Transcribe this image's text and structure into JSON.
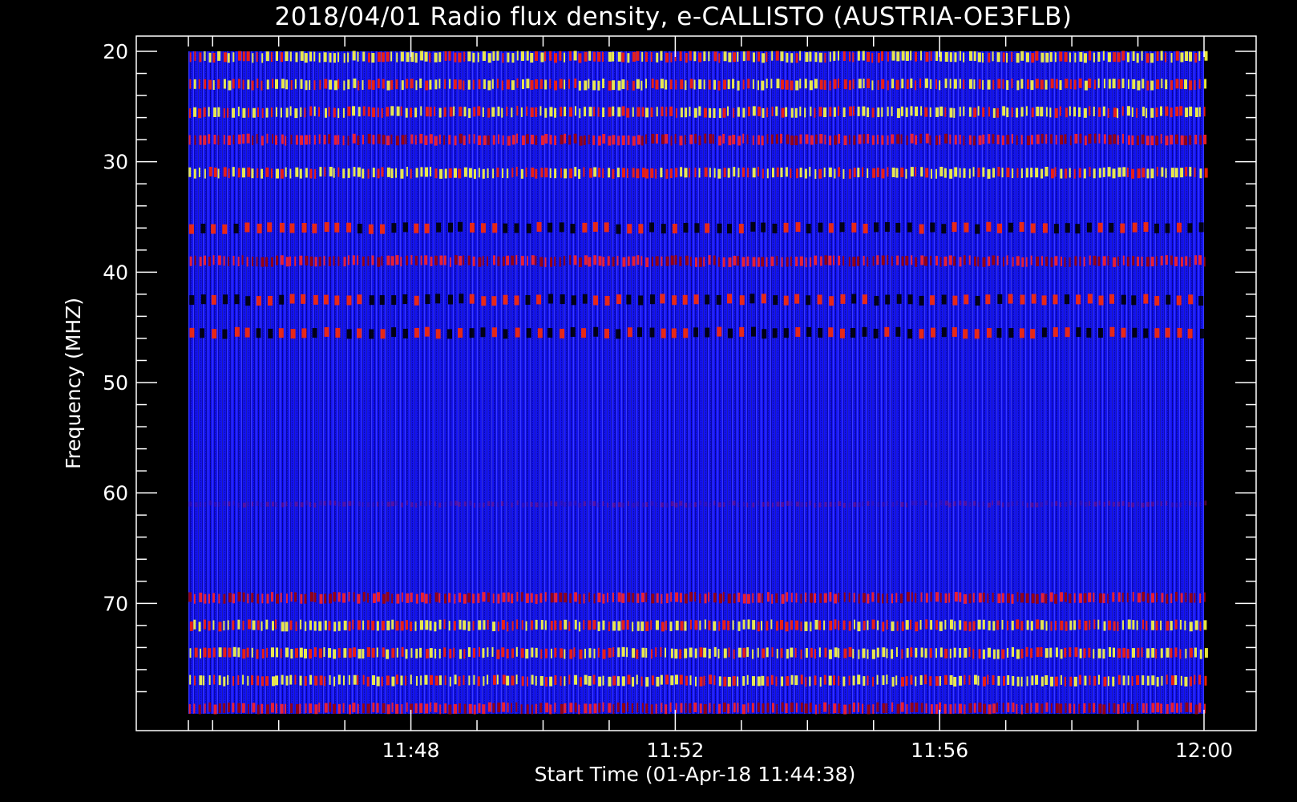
{
  "chart_data": {
    "type": "heatmap",
    "title": "2018/04/01  Radio flux density, e-CALLISTO (AUSTRIA-OE3FLB)",
    "xlabel": "Start Time (01-Apr-18 11:44:38)",
    "ylabel": "Frequency (MHZ)",
    "x_ticks": [
      "11:48",
      "11:52",
      "11:56",
      "12:00"
    ],
    "y_ticks": [
      "20",
      "30",
      "40",
      "50",
      "60",
      "70"
    ],
    "x_range": [
      "11:44:38",
      "12:00:00"
    ],
    "y_range_mhz": [
      20,
      80
    ],
    "y_axis_inverted": true,
    "colormap": [
      "#000000",
      "#0000ff",
      "#ff0000",
      "#ffff00",
      "#ffffff"
    ],
    "bright_bands_mhz": [
      {
        "center": 20.5,
        "intensity": "yellow"
      },
      {
        "center": 23,
        "intensity": "yellow"
      },
      {
        "center": 25.5,
        "intensity": "yellow"
      },
      {
        "center": 28,
        "intensity": "red"
      },
      {
        "center": 31,
        "intensity": "yellow"
      },
      {
        "center": 36,
        "intensity": "red-black"
      },
      {
        "center": 39,
        "intensity": "red"
      },
      {
        "center": 42.5,
        "intensity": "red-black"
      },
      {
        "center": 45.5,
        "intensity": "red-black"
      },
      {
        "center": 61,
        "intensity": "faint-red"
      },
      {
        "center": 69.5,
        "intensity": "red"
      },
      {
        "center": 72,
        "intensity": "yellow"
      },
      {
        "center": 74.5,
        "intensity": "yellow"
      },
      {
        "center": 77,
        "intensity": "yellow"
      },
      {
        "center": 79.5,
        "intensity": "red"
      }
    ]
  }
}
